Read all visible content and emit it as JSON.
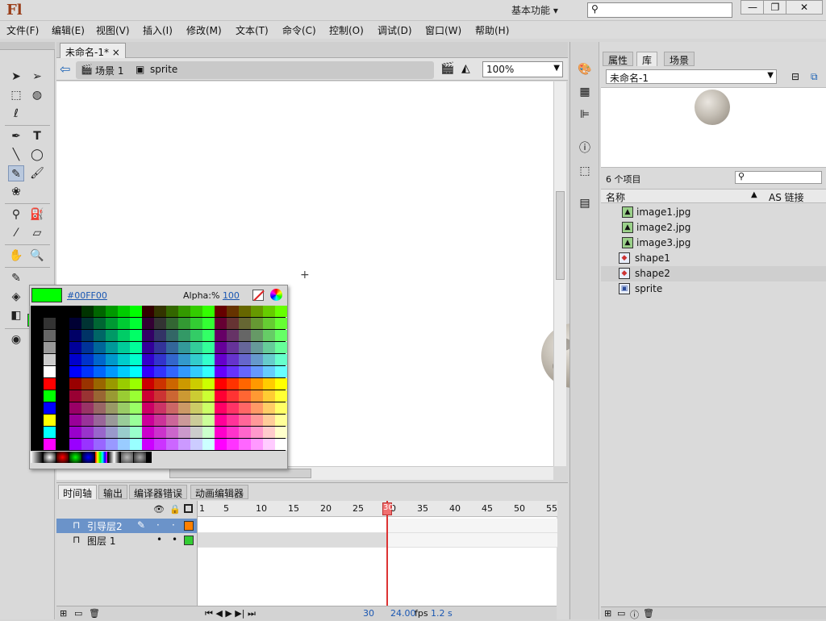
{
  "app": {
    "logo": "Fl",
    "workspace": "基本功能",
    "workspace_arrow": "▾"
  },
  "window_buttons": {
    "minimize": "—",
    "restore": "❐",
    "close": "✕"
  },
  "menu": [
    "文件(F)",
    "编辑(E)",
    "视图(V)",
    "插入(I)",
    "修改(M)",
    "文本(T)",
    "命令(C)",
    "控制(O)",
    "调试(D)",
    "窗口(W)",
    "帮助(H)"
  ],
  "document": {
    "tab_label": "未命名-1*",
    "tab_close": "×"
  },
  "editbar": {
    "back_arrow": "⇦",
    "scene": "场景 1",
    "symbol": "sprite",
    "zoom": "100%"
  },
  "toolbox": {
    "stroke_color": "#000000",
    "fill_color": "#00ff00",
    "tools": [
      "selection-tool",
      "subselection-tool",
      "free-transform-tool",
      "3d-rotation-tool",
      "lasso-tool",
      "pen-tool",
      "text-tool",
      "line-tool",
      "oval-tool",
      "pencil-tool",
      "brush-tool",
      "deco-tool",
      "bone-tool",
      "paint-bucket-tool",
      "eyedropper-tool",
      "eraser-tool",
      "hand-tool",
      "zoom-tool"
    ]
  },
  "color_picker": {
    "hex": "#00FF00",
    "alpha_label": "Alpha:%",
    "alpha_value": "100"
  },
  "timeline": {
    "tabs": [
      "时间轴",
      "输出",
      "编译器错误",
      "动画编辑器"
    ],
    "ruler": [
      "1",
      "5",
      "10",
      "15",
      "20",
      "25",
      "30",
      "35",
      "40",
      "45",
      "50",
      "55"
    ],
    "layers": [
      {
        "name": "引导层2",
        "selected": true,
        "color": "#ff8000"
      },
      {
        "name": "图层 1",
        "selected": false,
        "color": "#33cc33"
      }
    ],
    "current_frame": "30",
    "fps": "24.00",
    "fps_unit": "fps",
    "elapsed": "1.2 s"
  },
  "library": {
    "tabs": [
      "属性",
      "库",
      "场景"
    ],
    "document": "未命名-1",
    "count": "6 个项目",
    "col_name": "名称",
    "col_link": "AS 链接",
    "items": [
      {
        "name": "image1.jpg",
        "type": "bitmap"
      },
      {
        "name": "image2.jpg",
        "type": "bitmap"
      },
      {
        "name": "image3.jpg",
        "type": "bitmap"
      },
      {
        "name": "shape1",
        "type": "graphic"
      },
      {
        "name": "shape2",
        "type": "graphic",
        "selected": true
      },
      {
        "name": "sprite",
        "type": "movieclip"
      }
    ]
  }
}
